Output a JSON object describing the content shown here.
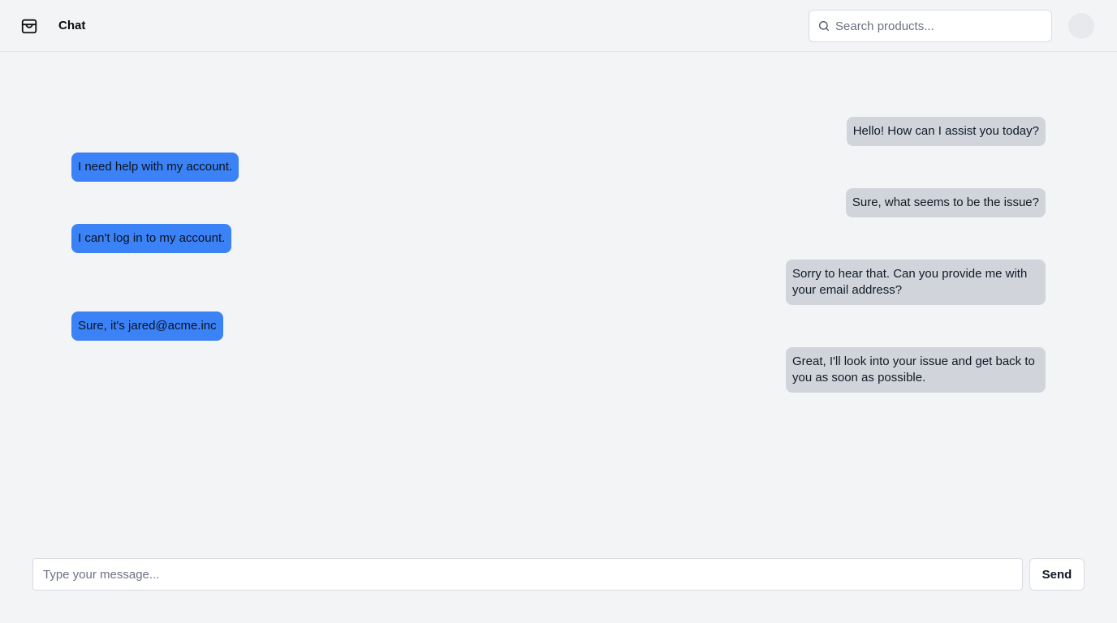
{
  "header": {
    "logo_icon": "package-icon",
    "title": "Chat",
    "search": {
      "icon": "search-icon",
      "placeholder": "Search products...",
      "value": ""
    },
    "avatar": "avatar"
  },
  "messages": [
    {
      "sender": "agent",
      "text": "Hello! How can I assist you today?"
    },
    {
      "sender": "user",
      "text": "I need help with my account."
    },
    {
      "sender": "agent",
      "text": "Sure, what seems to be the issue?"
    },
    {
      "sender": "user",
      "text": "I can't log in to my account."
    },
    {
      "sender": "agent",
      "text": "Sorry to hear that. Can you provide me with your email address?"
    },
    {
      "sender": "user",
      "text": "Sure, it's jared@acme.inc"
    },
    {
      "sender": "agent",
      "text": "Great, I'll look into your issue and get back to you as soon as possible."
    }
  ],
  "composer": {
    "placeholder": "Type your message...",
    "value": "",
    "send_label": "Send"
  },
  "colors": {
    "user_bubble": "#3b82f6",
    "agent_bubble": "#d1d5db",
    "background": "#f2f4f6"
  }
}
